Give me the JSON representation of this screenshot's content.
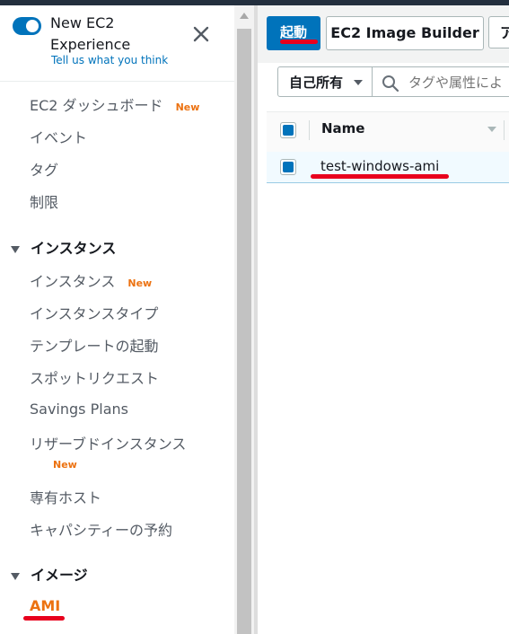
{
  "header": {
    "experience_title": "New EC2 Experience",
    "feedback_link": "Tell us what you think"
  },
  "sidebar": {
    "items": [
      {
        "label": "EC2 ダッシュボード",
        "badge": "New"
      },
      {
        "label": "イベント"
      },
      {
        "label": "タグ"
      },
      {
        "label": "制限"
      }
    ],
    "sections": [
      {
        "title": "インスタンス",
        "items": [
          {
            "label": "インスタンス",
            "badge": "New"
          },
          {
            "label": "インスタンスタイプ"
          },
          {
            "label": "テンプレートの起動"
          },
          {
            "label": "スポットリクエスト"
          },
          {
            "label": "Savings Plans"
          },
          {
            "label": "リザーブドインスタンス",
            "badge": "New"
          },
          {
            "label": "専有ホスト"
          },
          {
            "label": "キャパシティーの予約"
          }
        ]
      },
      {
        "title": "イメージ",
        "items": [
          {
            "label": "AMI",
            "active": true
          }
        ]
      }
    ]
  },
  "toolbar": {
    "launch_label": "起動",
    "image_builder_label": "EC2 Image Builder",
    "next_label_partial": "ア"
  },
  "filter": {
    "ownership_select": "自己所有",
    "search_placeholder": "タグや属性によ"
  },
  "table": {
    "columns": [
      "Name"
    ],
    "rows": [
      {
        "name": "test-windows-ami",
        "selected": true
      }
    ]
  },
  "colors": {
    "accent_blue": "#0073bb",
    "active_orange": "#ec7211",
    "annotation_red": "#e8001d"
  }
}
